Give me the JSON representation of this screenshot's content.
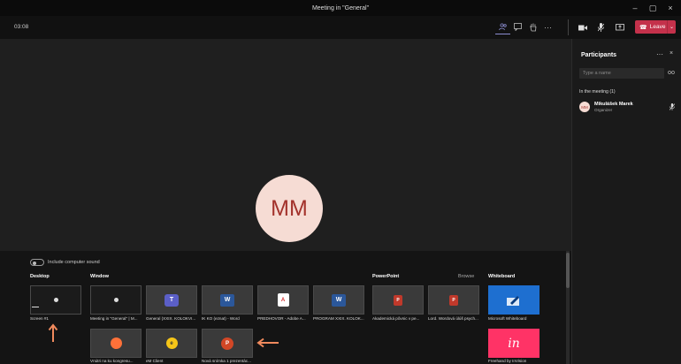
{
  "window": {
    "title": "Meeting in \"General\"",
    "minimize": "–",
    "maximize": "▢",
    "close": "×"
  },
  "toolbar": {
    "timer": "03:08",
    "icons": [
      "people-icon",
      "chat-icon",
      "raise-hand-icon",
      "more-icon"
    ],
    "more_label": "···"
  },
  "controls": {
    "leave_label": "Leave"
  },
  "stage": {
    "avatar_initials": "MM"
  },
  "share": {
    "include_sound_label": "Include computer sound",
    "sections": {
      "desktop": "Desktop",
      "window": "Window",
      "powerpoint": "PowerPoint",
      "browse": "Browse",
      "whiteboard": "Whiteboard"
    },
    "desktop_tiles": [
      {
        "caption": "Screen #1"
      }
    ],
    "window_tiles": [
      {
        "caption": "Meeting in \"General\" | M...",
        "icon": "teams-window"
      },
      {
        "caption": "General (XXIX. KOLOKVI...",
        "icon": "teams-icon"
      },
      {
        "caption": "IK KO (eznat) - Word",
        "icon": "word-icon"
      },
      {
        "caption": "PREDHOVOR - Adobe A...",
        "icon": "pdf-icon"
      },
      {
        "caption": "PROGRAM XXIX. KOLOK...",
        "icon": "word-icon"
      },
      {
        "caption": "Vnútri na ku kongresu...",
        "icon": "firefox-icon"
      },
      {
        "caption": "eM Client",
        "icon": "emclient-icon"
      },
      {
        "caption": "Nová snímka 1 prezentác...",
        "icon": "powerpoint-icon"
      }
    ],
    "powerpoint_tiles": [
      {
        "caption": "Akademická pôvnic v pe...",
        "icon": "pptx-icon"
      },
      {
        "caption": "Lord. Wordová úlúš psych...",
        "icon": "pptx-icon"
      }
    ],
    "whiteboard_tiles": [
      {
        "caption": "Microsoft Whiteboard",
        "icon": "whiteboard-icon"
      },
      {
        "caption": "Freehand by InVision",
        "icon": "invision-icon"
      }
    ],
    "invision_glyph": "in"
  },
  "participants": {
    "title": "Participants",
    "more_label": "···",
    "close_label": "×",
    "search_placeholder": "Type a name",
    "in_meeting_label": "In the meeting (1)",
    "people": [
      {
        "initials": "MM",
        "name": "Mikulášek Marek",
        "role": "Organizer"
      }
    ]
  },
  "colors": {
    "accent": "#8b8ccf",
    "leave": "#c4314b",
    "avatar_bg": "#f6dcd4",
    "avatar_fg": "#a3322c",
    "annotation_arrow": "#f08a5d"
  }
}
